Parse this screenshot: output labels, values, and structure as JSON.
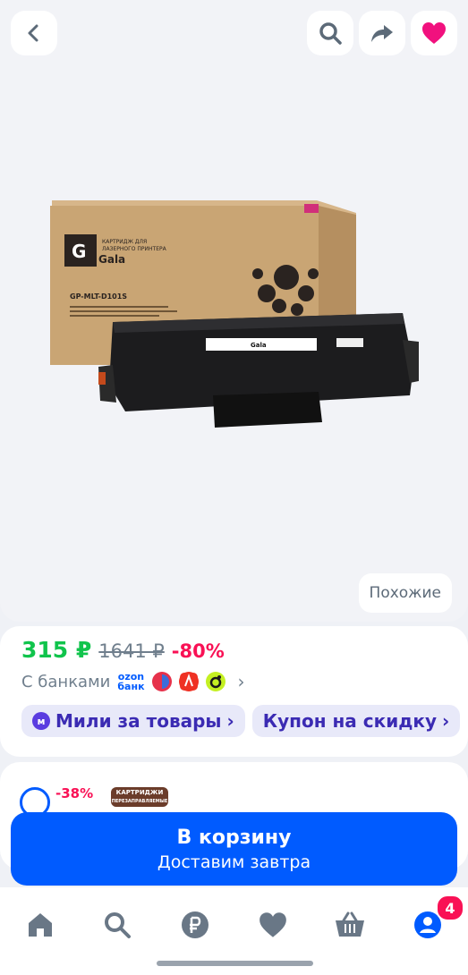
{
  "header": {
    "back_icon": "chevron-left-icon",
    "search_icon": "search-icon",
    "share_icon": "share-icon",
    "favorite_icon": "heart-icon"
  },
  "gallery": {
    "similar_label": "Похожие",
    "box_brand": "Gala",
    "box_caption_line1": "КАРТРИДЖ ДЛЯ",
    "box_caption_line2": "ЛАЗЕРНОГО ПРИНТЕРА",
    "box_model": "GP-MLT-D101S"
  },
  "price": {
    "current": "315 ₽",
    "old": "1641 ₽",
    "discount": "-80%"
  },
  "banks": {
    "label": "С банками",
    "ozon_line1": "ozon",
    "ozon_line2": "банк"
  },
  "chips": {
    "miles": "Мили за товары",
    "coupon": "Купон на скидку"
  },
  "next_card": {
    "discount": "-38%",
    "tag_line1": "КАРТРИДЖИ",
    "tag_line2": "ПЕРЕЗАПРАВЛЯЕМЫЕ"
  },
  "cart": {
    "title": "В корзину",
    "subtitle": "Доставим завтра"
  },
  "nav": {
    "items": [
      "home-icon",
      "search-icon",
      "ruble-icon",
      "heart-icon",
      "basket-icon",
      "profile-icon"
    ],
    "profile_badge": "4"
  },
  "colors": {
    "accent": "#005bff",
    "price": "#10c44c",
    "discount": "#f91155",
    "favorite": "#f1117e"
  }
}
